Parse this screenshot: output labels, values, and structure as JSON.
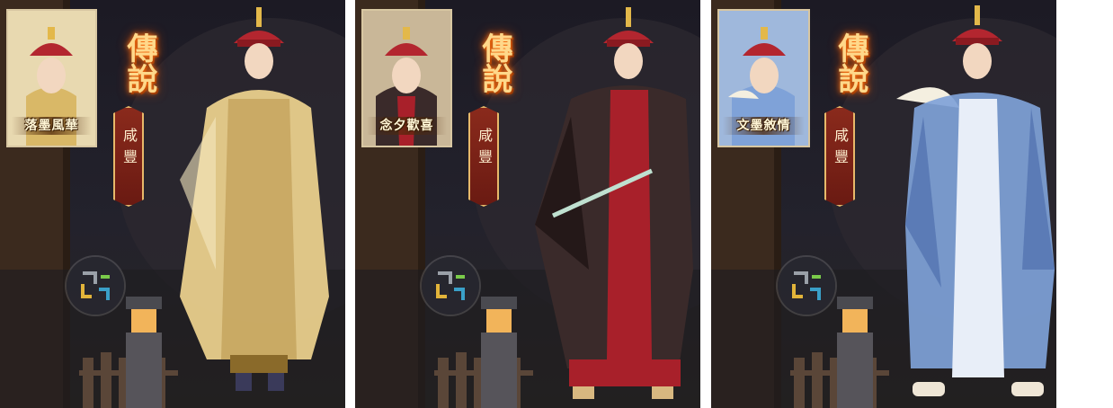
{
  "panels": [
    {
      "legend": "傳說",
      "emperor": "咸豐",
      "portrait_label": "落墨風華",
      "robe_main": "#e9cf8c",
      "robe_shadow": "#b89448",
      "robe_accent": "#8a6a2a",
      "portrait_bg": "#e8d9b0"
    },
    {
      "legend": "傳說",
      "emperor": "咸豐",
      "portrait_label": "念夕歡喜",
      "robe_main": "#3a2a2a",
      "robe_shadow": "#241818",
      "robe_accent": "#a8202a",
      "portrait_bg": "#c9b798"
    },
    {
      "legend": "傳說",
      "emperor": "咸豐",
      "portrait_label": "文墨敘情",
      "robe_main": "#7fa2d8",
      "robe_shadow": "#4f6fae",
      "robe_accent": "#e8eef8",
      "portrait_bg": "#9fb8dc"
    }
  ],
  "icons": [
    "game-logo-icon",
    "lantern-icon",
    "crown-hat-icon"
  ],
  "colors": {
    "frame_gold": "#d8c7a2",
    "legend_glow": "#ff7a1a",
    "tag_red": "#8a2a1c"
  }
}
